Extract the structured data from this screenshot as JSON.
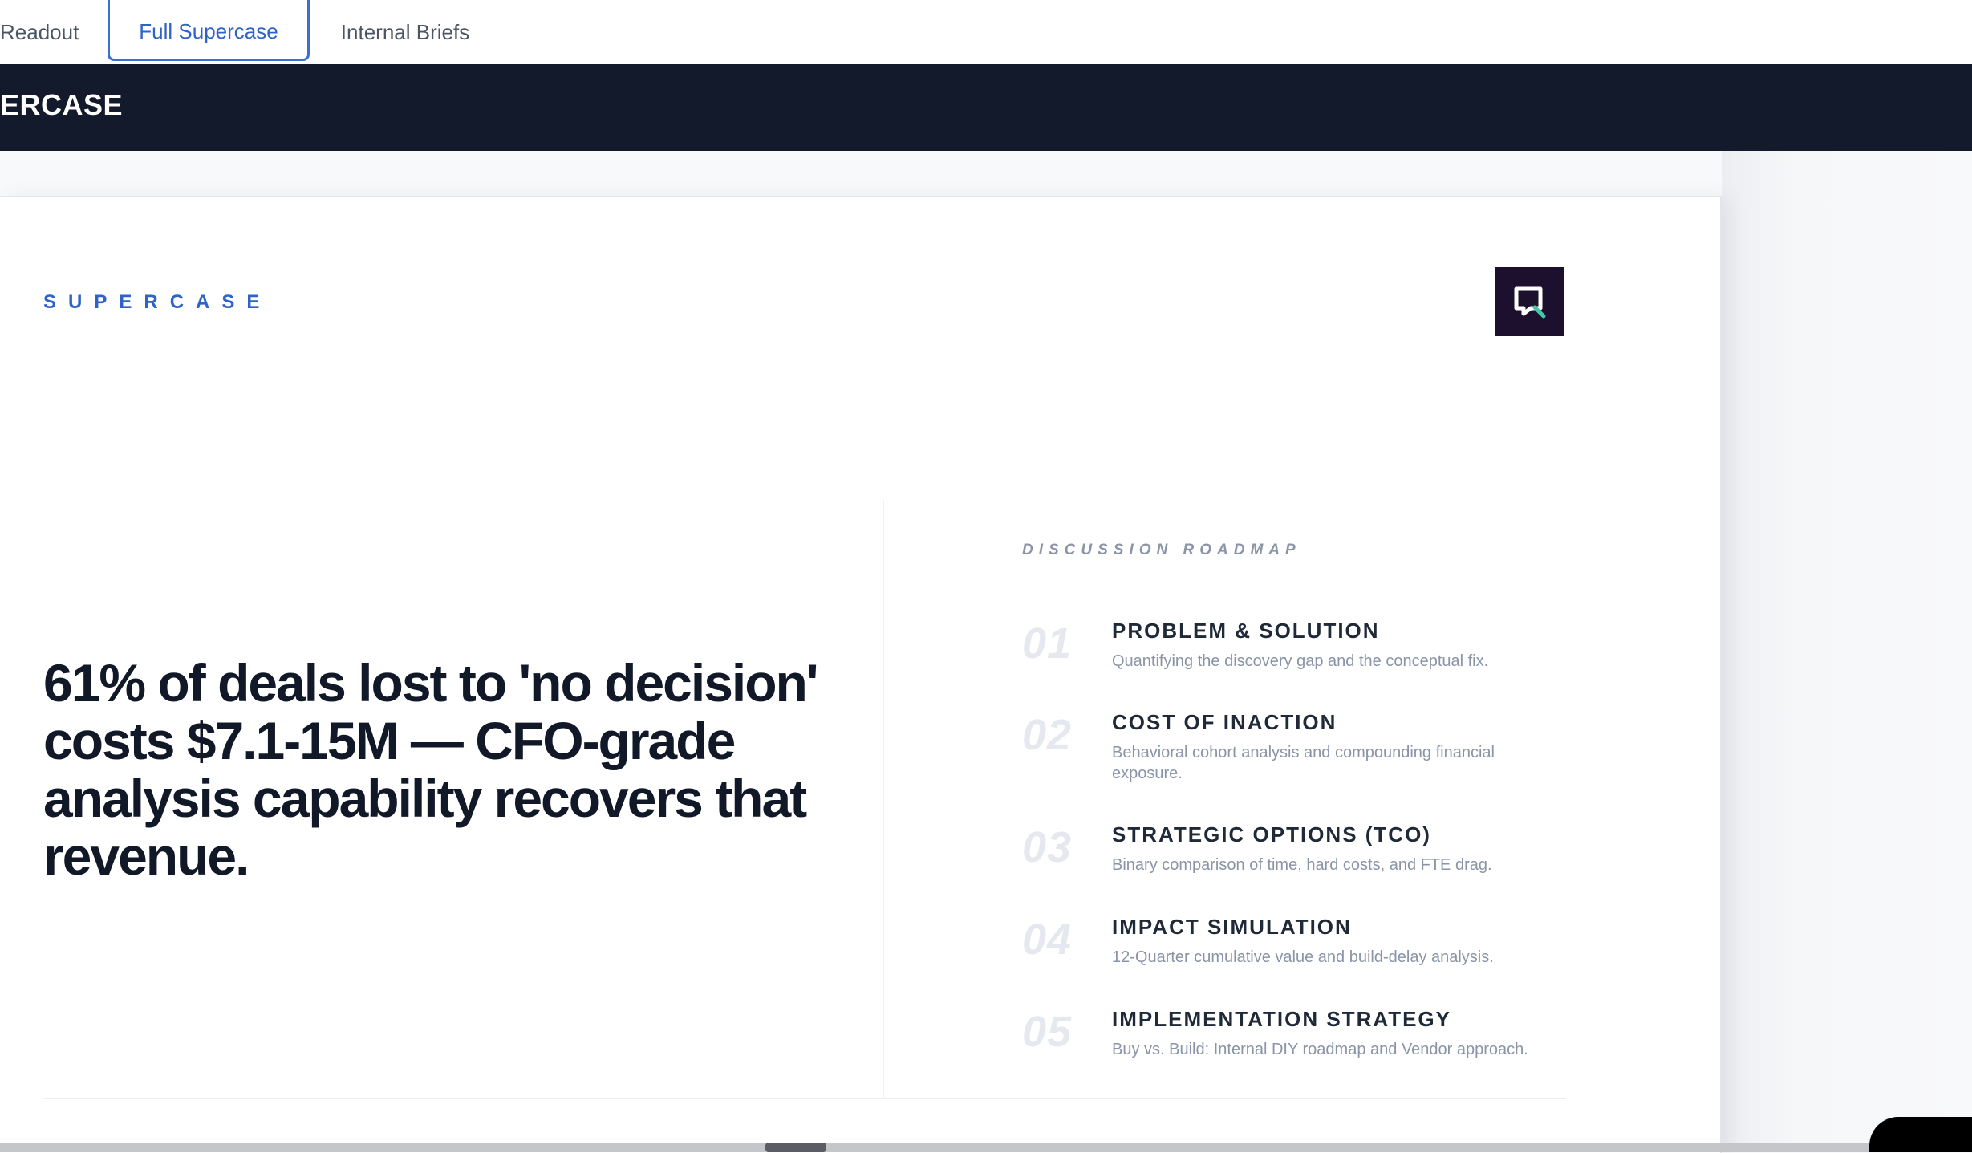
{
  "tabs": {
    "readout": "Readout",
    "full_supercase": "Full Supercase",
    "internal_briefs": "Internal Briefs"
  },
  "header": {
    "title": "ERCASE"
  },
  "slide": {
    "brand": "SUPERCASE",
    "logo_icon": "search-chat-logo-icon",
    "headline": "61% of deals lost to 'no decision' costs $7.1-15M — CFO-grade analysis capability recovers that revenue.",
    "roadmap_label": "DISCUSSION ROADMAP",
    "roadmap": [
      {
        "num": "01",
        "title": "PROBLEM & SOLUTION",
        "desc": "Quantifying the discovery gap and the conceptual fix."
      },
      {
        "num": "02",
        "title": "COST OF INACTION",
        "desc": "Behavioral cohort analysis and compounding financial exposure."
      },
      {
        "num": "03",
        "title": "STRATEGIC OPTIONS (TCO)",
        "desc": "Binary comparison of time, hard costs, and FTE drag."
      },
      {
        "num": "04",
        "title": "IMPACT SIMULATION",
        "desc": "12-Quarter cumulative value and build-delay analysis."
      },
      {
        "num": "05",
        "title": "IMPLEMENTATION STRATEGY",
        "desc": "Buy vs. Build: Internal DIY roadmap and Vendor approach."
      }
    ]
  },
  "colors": {
    "accent": "#2f63c8",
    "header_bg": "#131a2b",
    "logo_bg": "#1d0f2e",
    "logo_highlight": "#3fc9a8"
  }
}
